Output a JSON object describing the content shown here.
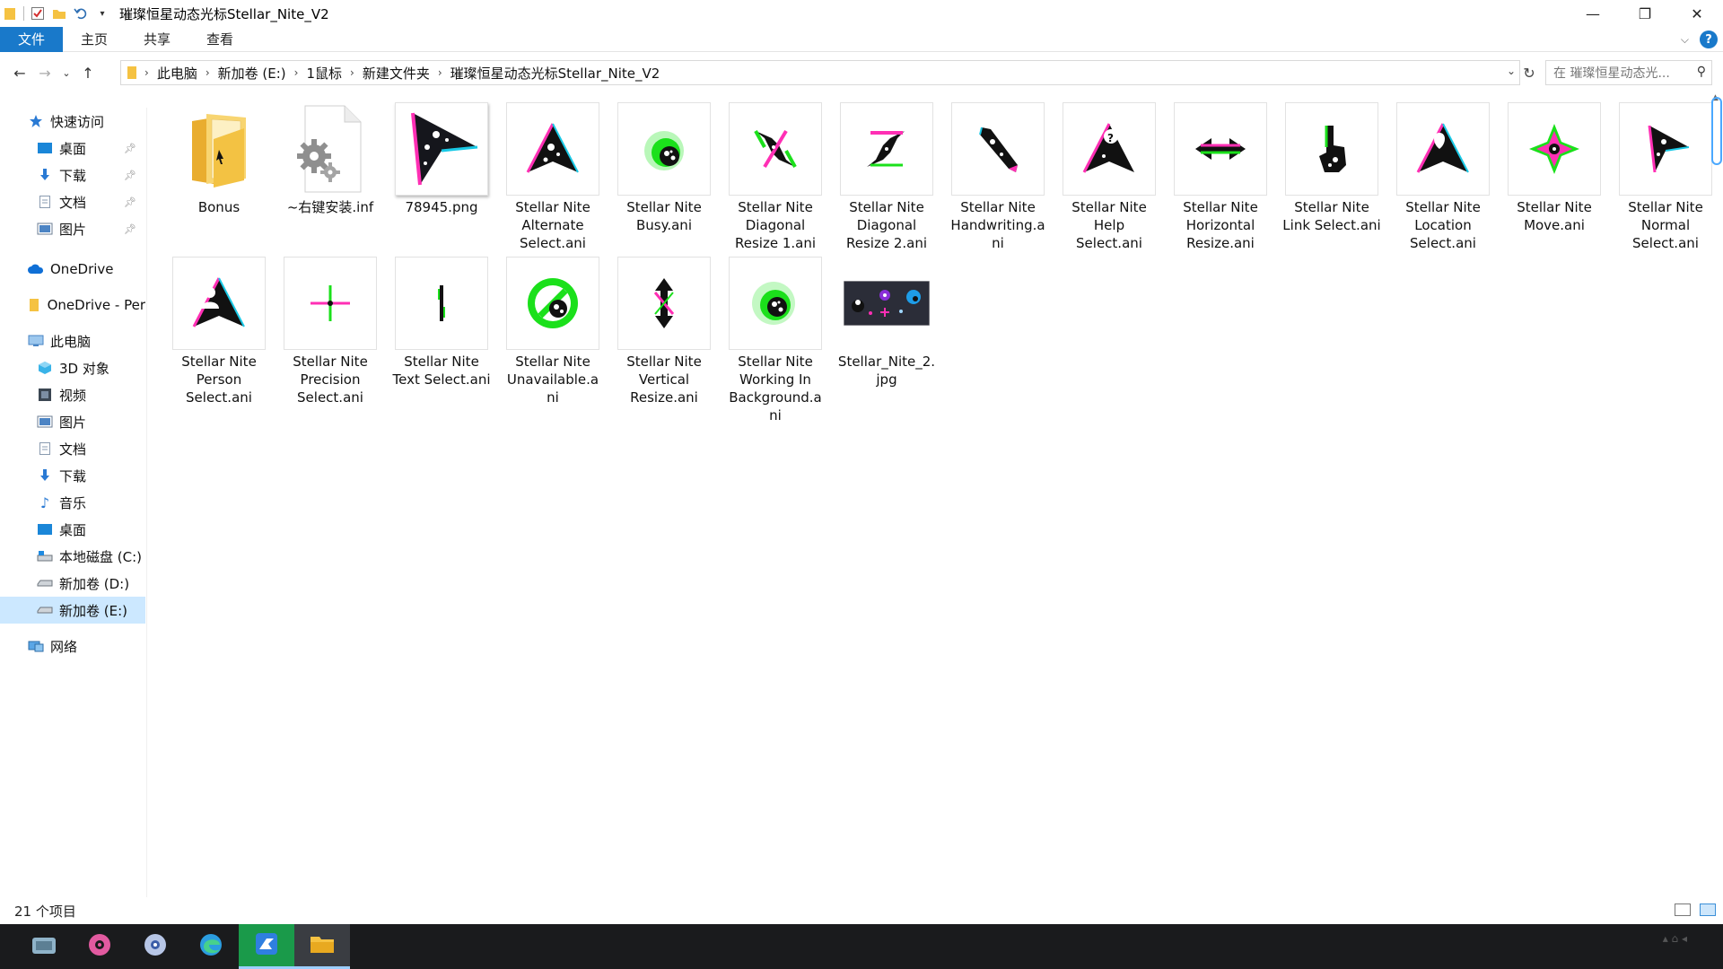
{
  "window": {
    "title": "璀璨恒星动态光标Stellar_Nite_V2",
    "minimize_glyph": "—",
    "maximize_glyph": "❐",
    "close_glyph": "✕"
  },
  "ribbon": {
    "tabs": [
      "文件",
      "主页",
      "共享",
      "查看"
    ],
    "help_glyph": "?"
  },
  "address": {
    "breadcrumb": [
      "此电脑",
      "新加卷 (E:)",
      "1鼠标",
      "新建文件夹",
      "璀璨恒星动态光标Stellar_Nite_V2"
    ],
    "search_placeholder": "在 璀璨恒星动态光..."
  },
  "sidebar": {
    "items": [
      {
        "label": "快速访问",
        "icon": "star-icon",
        "level": 0
      },
      {
        "label": "桌面",
        "icon": "desktop-icon",
        "level": 1,
        "pinned": true
      },
      {
        "label": "下载",
        "icon": "download-icon",
        "level": 1,
        "pinned": true
      },
      {
        "label": "文档",
        "icon": "document-icon",
        "level": 1,
        "pinned": true
      },
      {
        "label": "图片",
        "icon": "pictures-icon",
        "level": 1,
        "pinned": true
      },
      {
        "label": "OneDrive",
        "icon": "cloud-icon",
        "level": 0
      },
      {
        "label": "OneDrive - Per",
        "icon": "folder-icon",
        "level": 0
      },
      {
        "label": "此电脑",
        "icon": "pc-icon",
        "level": 0
      },
      {
        "label": "3D 对象",
        "icon": "cube-icon",
        "level": 1
      },
      {
        "label": "视频",
        "icon": "video-icon",
        "level": 1
      },
      {
        "label": "图片",
        "icon": "pictures-icon",
        "level": 1
      },
      {
        "label": "文档",
        "icon": "document-icon",
        "level": 1
      },
      {
        "label": "下载",
        "icon": "download-icon",
        "level": 1
      },
      {
        "label": "音乐",
        "icon": "music-icon",
        "level": 1
      },
      {
        "label": "桌面",
        "icon": "desktop-icon",
        "level": 1
      },
      {
        "label": "本地磁盘 (C:)",
        "icon": "drive-c-icon",
        "level": 1
      },
      {
        "label": "新加卷 (D:)",
        "icon": "drive-icon",
        "level": 1
      },
      {
        "label": "新加卷 (E:)",
        "icon": "drive-icon",
        "level": 1,
        "selected": true
      },
      {
        "label": "网络",
        "icon": "network-icon",
        "level": 0
      }
    ]
  },
  "files": [
    {
      "name": "Bonus",
      "kind": "folder"
    },
    {
      "name": "~右键安装.inf",
      "kind": "inf"
    },
    {
      "name": "78945.png",
      "kind": "png"
    },
    {
      "name": "Stellar Nite Alternate Select.ani",
      "kind": "cursor-arrow"
    },
    {
      "name": "Stellar Nite Busy.ani",
      "kind": "cursor-busy"
    },
    {
      "name": "Stellar Nite Diagonal Resize 1.ani",
      "kind": "cursor-diag1"
    },
    {
      "name": "Stellar Nite Diagonal Resize 2.ani",
      "kind": "cursor-diag2"
    },
    {
      "name": "Stellar Nite Handwriting.ani",
      "kind": "cursor-pen"
    },
    {
      "name": "Stellar Nite Help Select.ani",
      "kind": "cursor-help"
    },
    {
      "name": "Stellar Nite Horizontal Resize.ani",
      "kind": "cursor-hresize"
    },
    {
      "name": "Stellar Nite Link Select.ani",
      "kind": "cursor-hand"
    },
    {
      "name": "Stellar Nite Location Select.ani",
      "kind": "cursor-location"
    },
    {
      "name": "Stellar Nite Move.ani",
      "kind": "cursor-move"
    },
    {
      "name": "Stellar Nite Normal Select.ani",
      "kind": "cursor-normal"
    },
    {
      "name": "Stellar Nite Person Select.ani",
      "kind": "cursor-person"
    },
    {
      "name": "Stellar Nite Precision Select.ani",
      "kind": "cursor-cross"
    },
    {
      "name": "Stellar Nite Text Select.ani",
      "kind": "cursor-text"
    },
    {
      "name": "Stellar Nite Unavailable.ani",
      "kind": "cursor-unavailable"
    },
    {
      "name": "Stellar Nite Vertical Resize.ani",
      "kind": "cursor-vresize"
    },
    {
      "name": "Stellar Nite Working In Background.ani",
      "kind": "cursor-working"
    },
    {
      "name": "Stellar_Nite_2.jpg",
      "kind": "jpg"
    }
  ],
  "status": {
    "item_count": "21 个项目"
  },
  "colors": {
    "accent": "#1979ca",
    "selection": "#cce8ff",
    "cursor_black": "#111111",
    "cursor_magenta": "#ff2fb4",
    "cursor_green": "#1be01b",
    "cursor_cyan": "#19c9e6"
  }
}
